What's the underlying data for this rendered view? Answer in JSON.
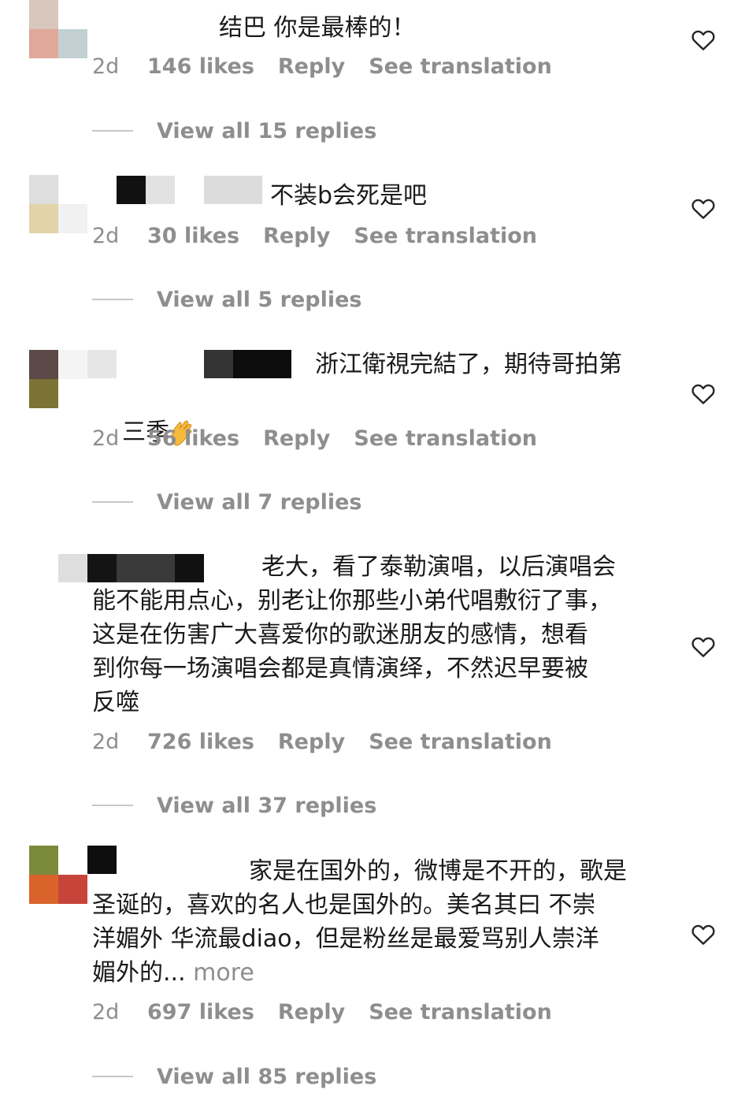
{
  "comments": [
    {
      "text": "结巴 你是最棒的！",
      "time": "2d",
      "likes": "146 likes",
      "reply": "Reply",
      "translate": "See translation",
      "view_replies": "View all 15 replies"
    },
    {
      "text": "不装b会死是吧",
      "time": "2d",
      "likes": "30 likes",
      "reply": "Reply",
      "translate": "See translation",
      "view_replies": "View all 5 replies"
    },
    {
      "text_line1": "浙江衛視完結了，期待哥拍第",
      "text_line2": "三季",
      "emoji": "clapping-hands-emoji",
      "time": "2d",
      "likes": "56 likes",
      "reply": "Reply",
      "translate": "See translation",
      "view_replies": "View all 7 replies"
    },
    {
      "text_line1": "老大，看了泰勒演唱，以后演唱会",
      "text_rest": "能不能用点心，别老让你那些小弟代唱敷衍了事，\n这是在伤害广大喜爱你的歌迷朋友的感情，想看\n到你每一场演唱会都是真情演绎，不然迟早要被\n反噬",
      "time": "2d",
      "likes": "726 likes",
      "reply": "Reply",
      "translate": "See translation",
      "view_replies": "View all 37 replies"
    },
    {
      "text_line1": "家是在国外的，微博是不开的，歌是",
      "text_rest": "圣诞的，喜欢的名人也是国外的。美名其曰 不崇\n洋媚外 华流最diao，但是粉丝是最爱骂别人崇洋\n媚外的...",
      "more": "more",
      "time": "2d",
      "likes": "697 likes",
      "reply": "Reply",
      "translate": "See translation",
      "view_replies": "View all 85 replies"
    }
  ],
  "icons": {
    "like": "heart-outline-icon"
  },
  "colors": {
    "meta": "#8e8e8e",
    "text": "#1a1a1a",
    "icon": "#262626"
  }
}
